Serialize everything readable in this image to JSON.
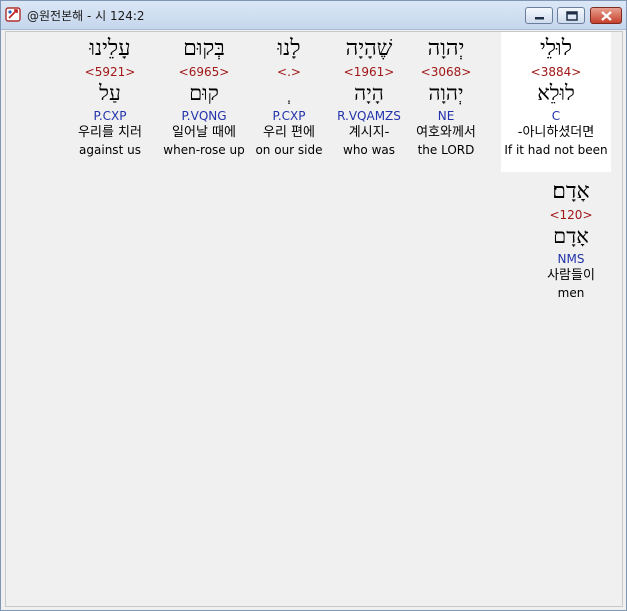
{
  "window": {
    "title": "@원전본해 - 시 124:2",
    "icon": "bible-app-icon",
    "controls": [
      "minimize",
      "maximize",
      "close"
    ]
  },
  "colors": {
    "strong": "#a01818",
    "morph": "#2233aa",
    "highlight_bg": "#ffffff"
  },
  "words": [
    {
      "hebrew": "לוּלֵי",
      "strong": "<3884>",
      "lexeme": "לוּלֵא",
      "morph": "C",
      "korean": "-아니하셨더면",
      "english": "If it had not been",
      "highlighted": true
    },
    {
      "hebrew": "יְהוָה",
      "strong": "<3068>",
      "lexeme": "יְהוָה",
      "morph": "NE",
      "korean": "여호와께서",
      "english": "the LORD",
      "highlighted": false
    },
    {
      "hebrew": "שֶׁהָיָה",
      "strong": "<1961>",
      "lexeme": "הָיָה",
      "morph": "R.VQAMZS",
      "korean": "계시지-",
      "english": "who was",
      "highlighted": false
    },
    {
      "hebrew": "לָנוּ",
      "strong": "<.>",
      "lexeme": "ְ",
      "morph": "P.CXP",
      "korean": "우리 편에",
      "english": "on our side",
      "highlighted": false
    },
    {
      "hebrew": "בְּקוּם",
      "strong": "<6965>",
      "lexeme": "קוּם",
      "morph": "P.VQNG",
      "korean": "일어날 때에",
      "english": "when-rose up",
      "highlighted": false
    },
    {
      "hebrew": "עָלֵינוּ",
      "strong": "<5921>",
      "lexeme": "עַל",
      "morph": "P.CXP",
      "korean": "우리를 치러",
      "english": "against us",
      "highlighted": false
    },
    {
      "hebrew": "אָדָם׃",
      "strong": "<120>",
      "lexeme": "אָדָם",
      "morph": "NMS",
      "korean": "사람들이",
      "english": "men",
      "highlighted": false
    }
  ]
}
